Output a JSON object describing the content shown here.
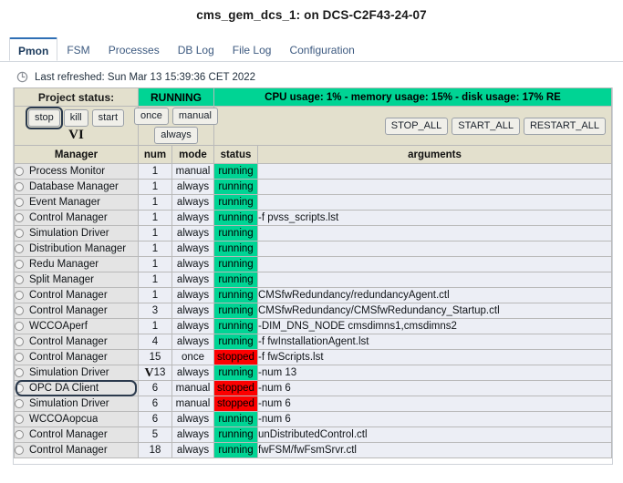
{
  "window": {
    "title": "cms_gem_dcs_1: on DCS-C2F43-24-07"
  },
  "tabs": [
    {
      "label": "Pmon",
      "active": true
    },
    {
      "label": "FSM",
      "active": false
    },
    {
      "label": "Processes",
      "active": false
    },
    {
      "label": "DB Log",
      "active": false
    },
    {
      "label": "File Log",
      "active": false
    },
    {
      "label": "Configuration",
      "active": false
    }
  ],
  "refresh": {
    "icon": "refresh-icon",
    "text": "Last refreshed: Sun Mar 13 15:39:36 CET 2022"
  },
  "status_bar": {
    "label": "Project status:",
    "state": "RUNNING",
    "usage": "CPU usage: 1% - memory usage: 15% - disk usage: 17%   RE"
  },
  "controls": {
    "process_buttons": [
      {
        "label": "stop",
        "focused": true
      },
      {
        "label": "kill",
        "focused": false
      },
      {
        "label": "start",
        "focused": false
      }
    ],
    "annotation": "VI",
    "mode_buttons_row1": [
      {
        "label": "once"
      },
      {
        "label": "manual"
      }
    ],
    "mode_buttons_row2": [
      {
        "label": "always"
      }
    ],
    "global_buttons": [
      {
        "label": "STOP_ALL"
      },
      {
        "label": "START_ALL"
      },
      {
        "label": "RESTART_ALL"
      }
    ]
  },
  "table": {
    "headers": {
      "manager": "Manager",
      "num": "num",
      "mode": "mode",
      "status": "status",
      "arguments": "arguments"
    },
    "rows": [
      {
        "manager": "Process Monitor",
        "num": "1",
        "mode": "manual",
        "status": "running",
        "arguments": "",
        "selected": false,
        "vmark": ""
      },
      {
        "manager": "Database Manager",
        "num": "1",
        "mode": "always",
        "status": "running",
        "arguments": "",
        "selected": false,
        "vmark": ""
      },
      {
        "manager": "Event Manager",
        "num": "1",
        "mode": "always",
        "status": "running",
        "arguments": "",
        "selected": false,
        "vmark": ""
      },
      {
        "manager": "Control Manager",
        "num": "1",
        "mode": "always",
        "status": "running",
        "arguments": "-f pvss_scripts.lst",
        "selected": false,
        "vmark": ""
      },
      {
        "manager": "Simulation Driver",
        "num": "1",
        "mode": "always",
        "status": "running",
        "arguments": "",
        "selected": false,
        "vmark": ""
      },
      {
        "manager": "Distribution Manager",
        "num": "1",
        "mode": "always",
        "status": "running",
        "arguments": "",
        "selected": false,
        "vmark": ""
      },
      {
        "manager": "Redu Manager",
        "num": "1",
        "mode": "always",
        "status": "running",
        "arguments": "",
        "selected": false,
        "vmark": ""
      },
      {
        "manager": "Split Manager",
        "num": "1",
        "mode": "always",
        "status": "running",
        "arguments": "",
        "selected": false,
        "vmark": ""
      },
      {
        "manager": "Control Manager",
        "num": "1",
        "mode": "always",
        "status": "running",
        "arguments": "CMSfwRedundancy/redundancyAgent.ctl",
        "selected": false,
        "vmark": ""
      },
      {
        "manager": "Control Manager",
        "num": "3",
        "mode": "always",
        "status": "running",
        "arguments": "CMSfwRedundancy/CMSfwRedundancy_Startup.ctl",
        "selected": false,
        "vmark": ""
      },
      {
        "manager": "WCCOAperf",
        "num": "1",
        "mode": "always",
        "status": "running",
        "arguments": "-DIM_DNS_NODE cmsdimns1,cmsdimns2",
        "selected": false,
        "vmark": ""
      },
      {
        "manager": "Control Manager",
        "num": "4",
        "mode": "always",
        "status": "running",
        "arguments": "-f fwInstallationAgent.lst",
        "selected": false,
        "vmark": ""
      },
      {
        "manager": "Control Manager",
        "num": "15",
        "mode": "once",
        "status": "stopped",
        "arguments": "-f fwScripts.lst",
        "selected": false,
        "vmark": ""
      },
      {
        "manager": "Simulation Driver",
        "num": "13",
        "mode": "always",
        "status": "running",
        "arguments": "-num 13",
        "selected": false,
        "vmark": "V"
      },
      {
        "manager": "OPC DA Client",
        "num": "6",
        "mode": "manual",
        "status": "stopped",
        "arguments": "-num 6",
        "selected": true,
        "vmark": ""
      },
      {
        "manager": "Simulation Driver",
        "num": "6",
        "mode": "manual",
        "status": "stopped",
        "arguments": "-num 6",
        "selected": false,
        "vmark": ""
      },
      {
        "manager": "WCCOAopcua",
        "num": "6",
        "mode": "always",
        "status": "running",
        "arguments": "-num 6",
        "selected": false,
        "vmark": ""
      },
      {
        "manager": "Control Manager",
        "num": "5",
        "mode": "always",
        "status": "running",
        "arguments": "unDistributedControl.ctl",
        "selected": false,
        "vmark": ""
      },
      {
        "manager": "Control Manager",
        "num": "18",
        "mode": "always",
        "status": "running",
        "arguments": "fwFSM/fwFsmSrvr.ctl",
        "selected": false,
        "vmark": ""
      }
    ]
  },
  "colors": {
    "running": "#00d494",
    "stopped": "#fd0000",
    "header_beige": "#e3e0cd",
    "accent_tab": "#2f6fb5",
    "highlight_ring": "#2b3a4d"
  }
}
